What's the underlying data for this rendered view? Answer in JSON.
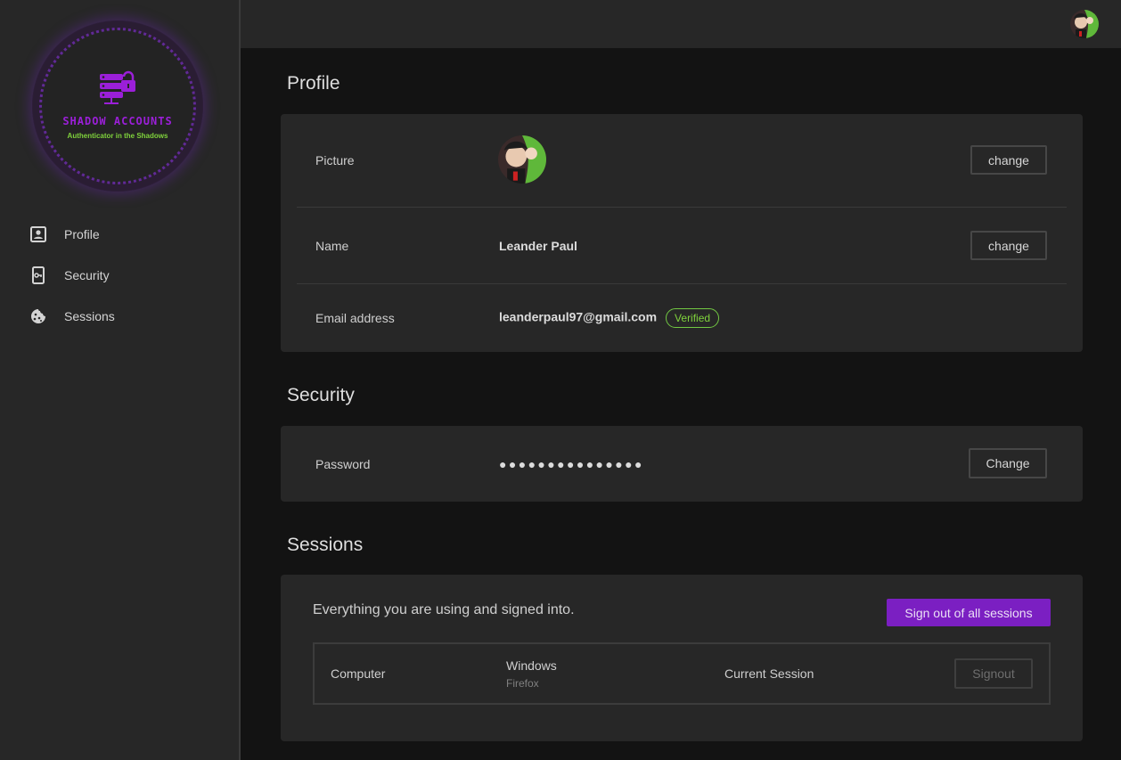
{
  "logo": {
    "title": "SHADOW ACCOUNTS",
    "subtitle": "Authenticator in the Shadows"
  },
  "sidebar": {
    "items": [
      {
        "label": "Profile",
        "icon": "account-box-icon"
      },
      {
        "label": "Security",
        "icon": "phone-key-icon"
      },
      {
        "label": "Sessions",
        "icon": "cookie-icon"
      }
    ]
  },
  "profile": {
    "title": "Profile",
    "picture_label": "Picture",
    "name_label": "Name",
    "name_value": "Leander Paul",
    "email_label": "Email address",
    "email_value": "leanderpaul97@gmail.com",
    "verified_badge": "Verified",
    "change_picture_label": "change",
    "change_name_label": "change"
  },
  "security": {
    "title": "Security",
    "password_label": "Password",
    "password_mask": "●●●●●●●●●●●●●●●",
    "change_label": "Change"
  },
  "sessions": {
    "title": "Sessions",
    "description": "Everything you are using and signed into.",
    "signout_all_label": "Sign out of all sessions",
    "list": [
      {
        "device": "Computer",
        "os": "Windows",
        "browser": "Firefox",
        "status": "Current Session",
        "signout_label": "Signout"
      }
    ]
  },
  "colors": {
    "accent": "#7b1fc2",
    "verified": "#7fd23c",
    "background": "#131313",
    "surface": "#272727"
  }
}
